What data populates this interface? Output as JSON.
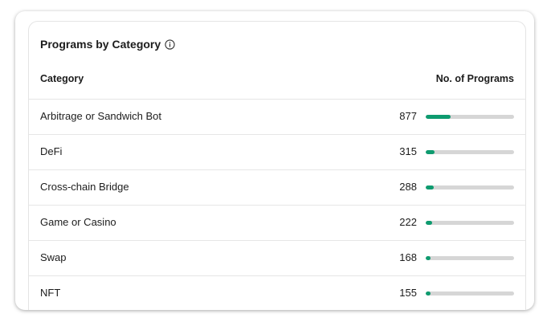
{
  "card": {
    "title": "Programs by Category"
  },
  "table": {
    "headers": {
      "category": "Category",
      "count": "No. of Programs"
    },
    "rows": [
      {
        "category": "Arbitrage or Sandwich Bot",
        "count": "877",
        "fraction": 0.28
      },
      {
        "category": "DeFi",
        "count": "315",
        "fraction": 0.1
      },
      {
        "category": "Cross-chain Bridge",
        "count": "288",
        "fraction": 0.09
      },
      {
        "category": "Game or Casino",
        "count": "222",
        "fraction": 0.07
      },
      {
        "category": "Swap",
        "count": "168",
        "fraction": 0.055
      },
      {
        "category": "NFT",
        "count": "155",
        "fraction": 0.05
      }
    ]
  },
  "colors": {
    "accent": "#0e9b6f",
    "track": "#d6d6d6"
  },
  "icons": {
    "info": "info-icon"
  }
}
